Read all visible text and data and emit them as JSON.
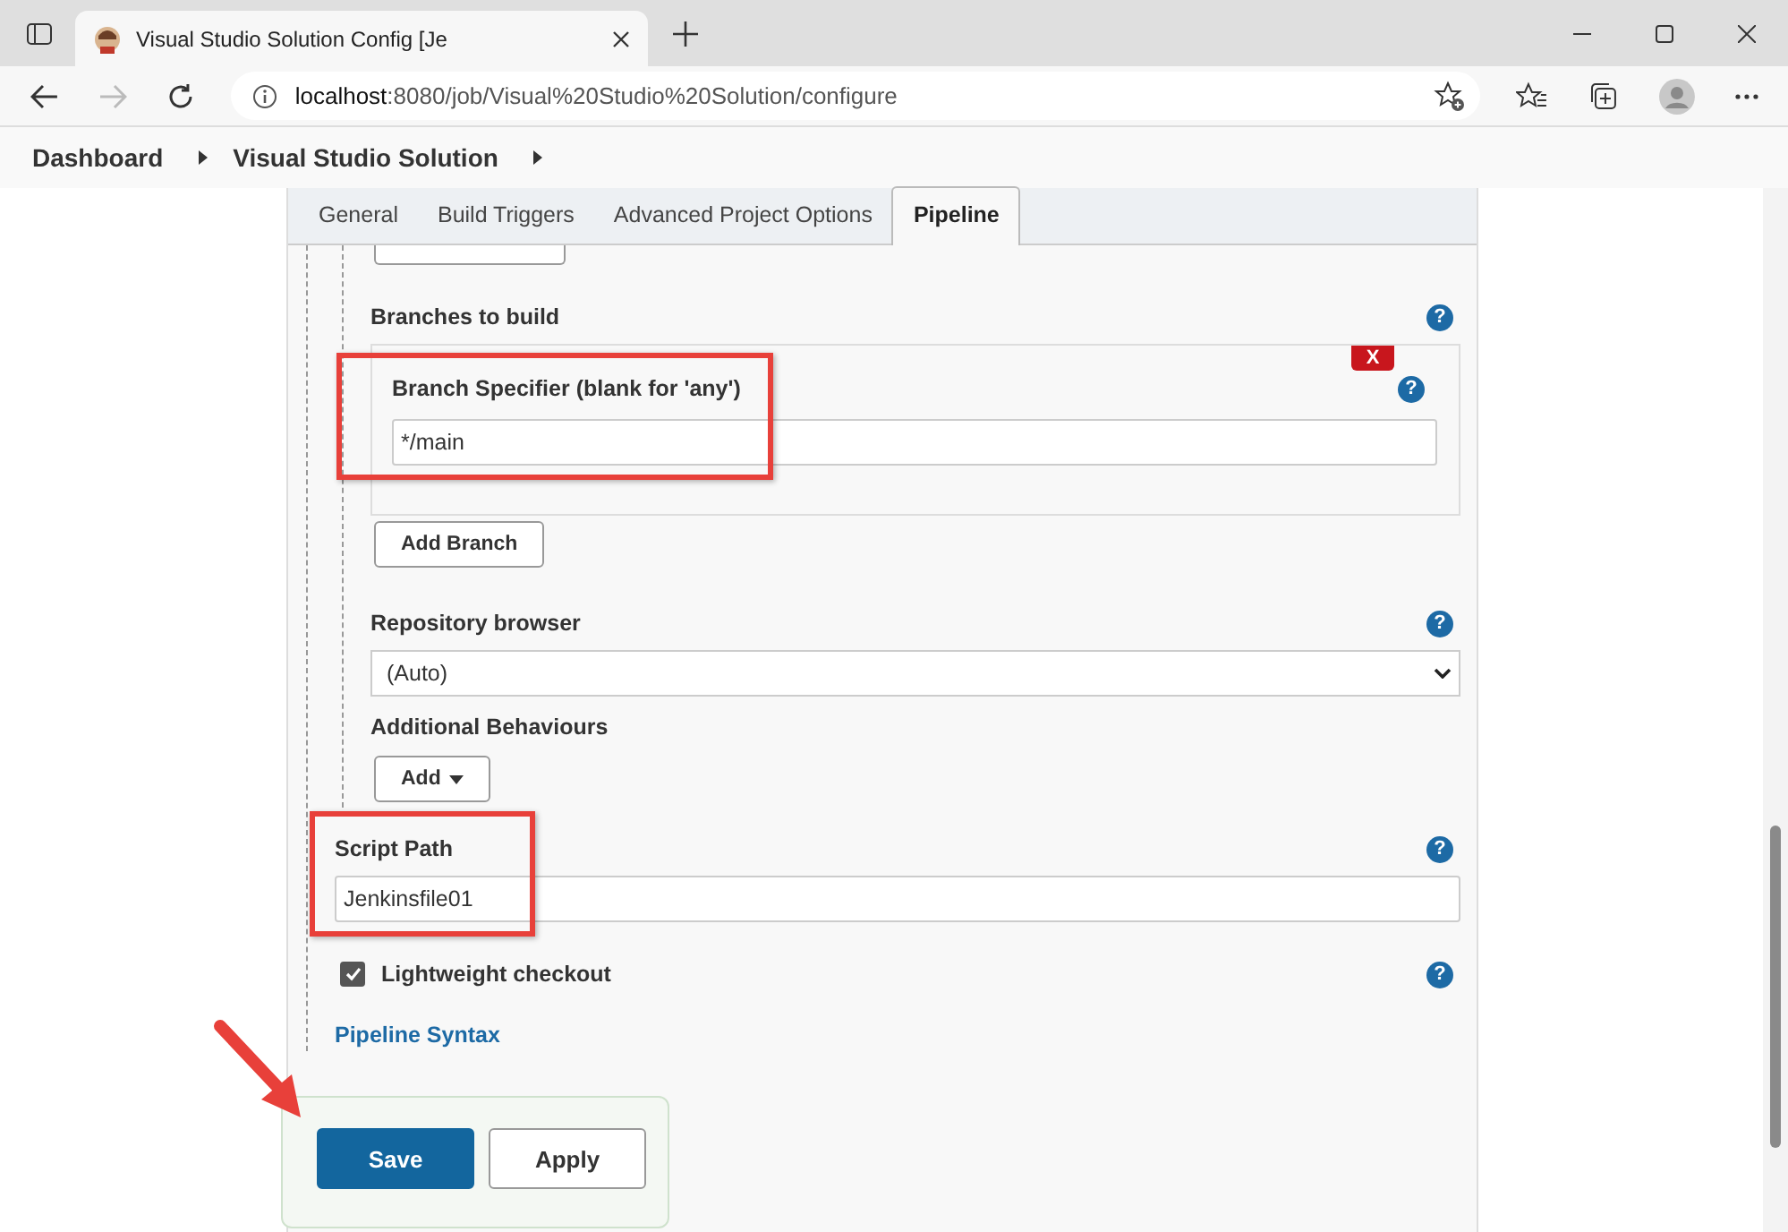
{
  "browser": {
    "tab_title": "Visual Studio Solution Config [Je",
    "url_host": "localhost",
    "url_path": ":8080/job/Visual%20Studio%20Solution/configure"
  },
  "breadcrumbs": [
    {
      "label": "Dashboard"
    },
    {
      "label": "Visual Studio Solution"
    }
  ],
  "tabs": [
    {
      "label": "General",
      "selected": false
    },
    {
      "label": "Build Triggers",
      "selected": false
    },
    {
      "label": "Advanced Project Options",
      "selected": false
    },
    {
      "label": "Pipeline",
      "selected": true
    }
  ],
  "branches": {
    "label": "Branches to build",
    "help": "?",
    "delete_label": "X",
    "specifier_label": "Branch Specifier (blank for 'any')",
    "specifier_help": "?",
    "specifier_value": "*/main",
    "add_button": "Add Branch"
  },
  "repository_browser": {
    "label": "Repository browser",
    "help": "?",
    "value": "(Auto)"
  },
  "additional_behaviours": {
    "label": "Additional Behaviours",
    "add_button": "Add"
  },
  "script_path": {
    "label": "Script Path",
    "help": "?",
    "value": "Jenkinsfile01"
  },
  "lightweight_checkout": {
    "label": "Lightweight checkout",
    "help": "?",
    "checked": true
  },
  "pipeline_syntax_link": "Pipeline Syntax",
  "buttons": [
    {
      "label": "Save",
      "kind": "primary"
    },
    {
      "label": "Apply",
      "kind": "secondary"
    }
  ]
}
